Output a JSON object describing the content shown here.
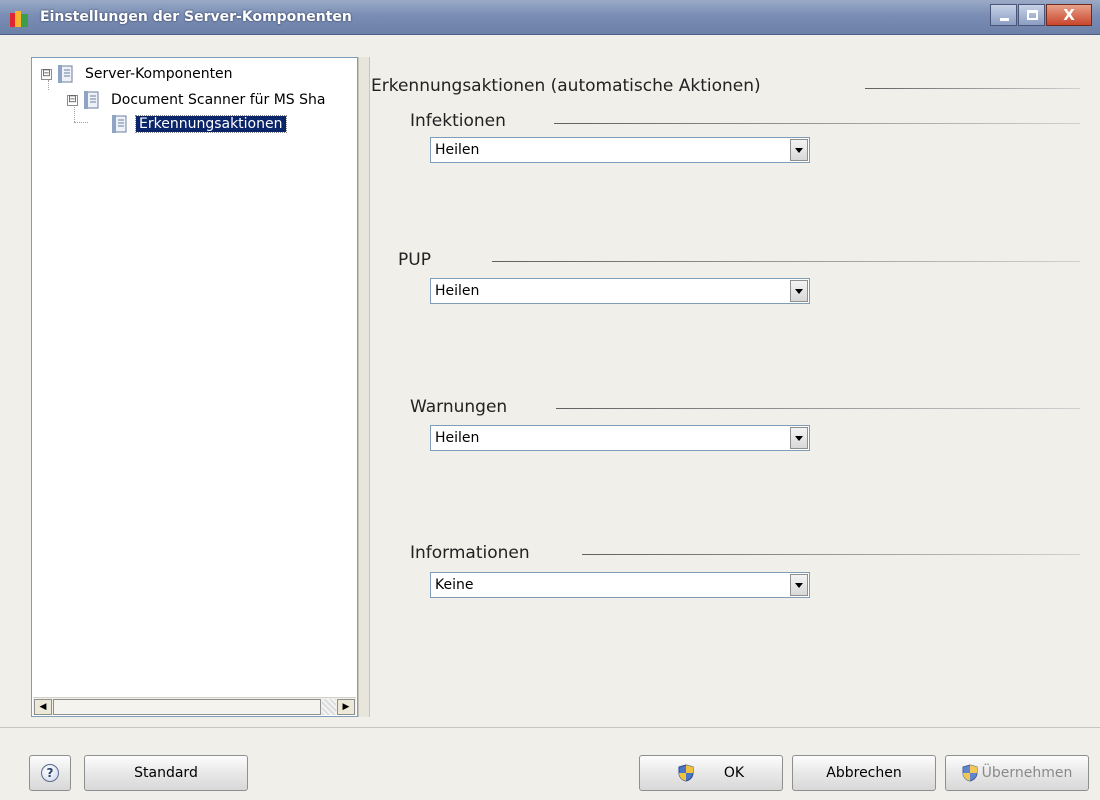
{
  "window": {
    "title": "Einstellungen der Server-Komponenten",
    "close_glyph": "X"
  },
  "tree": {
    "nodes": [
      {
        "label": "Server-Komponenten",
        "expander": "⊟"
      },
      {
        "label": "Document Scanner für MS Sha",
        "expander": "⊟"
      },
      {
        "label": "Erkennungsaktionen",
        "selected": true
      }
    ],
    "scroll_left": "◀",
    "scroll_right": "▶"
  },
  "panel": {
    "title": "Erkennungsaktionen (automatische Aktionen)",
    "groups": [
      {
        "label": "Infektionen",
        "value": "Heilen"
      },
      {
        "label": "PUP",
        "value": "Heilen"
      },
      {
        "label": "Warnungen",
        "value": "Heilen"
      },
      {
        "label": "Informationen",
        "value": "Keine"
      }
    ]
  },
  "buttons": {
    "help": "?",
    "standard": "Standard",
    "ok": "OK",
    "cancel": "Abbrechen",
    "apply": "Übernehmen"
  },
  "colors": {
    "selection": "#0a246a",
    "titlebar": "#7a8db4"
  }
}
